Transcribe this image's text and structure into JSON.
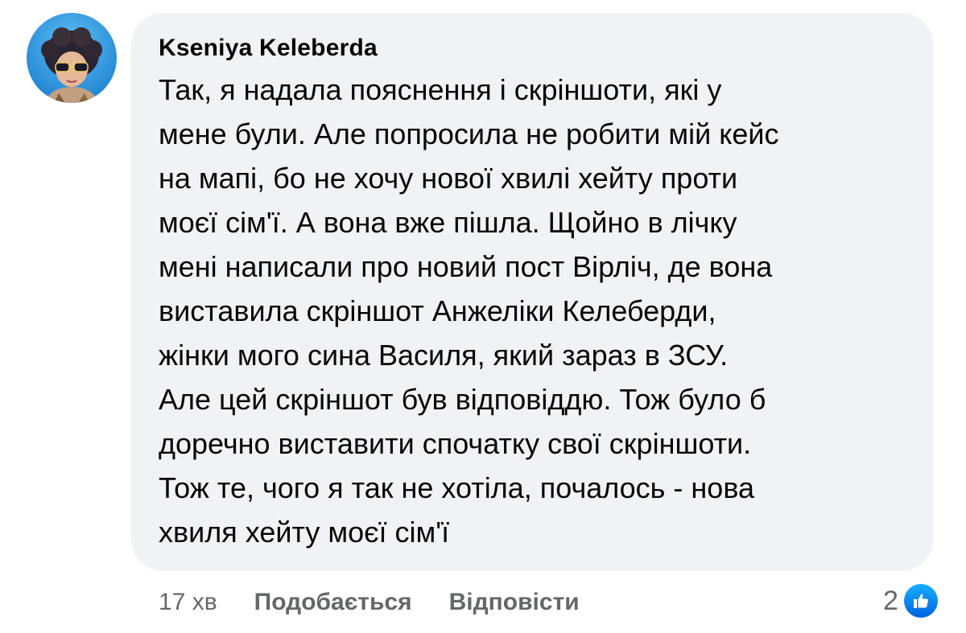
{
  "comment": {
    "author": "Kseniya  Keleberda",
    "text_lines": [
      "Так, я надала пояснення і скріншоти, які у",
      "мене були. Але попросила не робити мій кейс",
      "на мапі, бо не хочу нової хвилі хейту проти",
      "моєї сім'ї. А вона вже пішла. Щойно в лічку",
      "мені написали про новий пост Вірліч, де вона",
      "виставила скріншот Анжеліки Келеберди,",
      "жінки мого сина Василя, який зараз в ЗСУ.",
      "Але цей скріншот був відповіддю. Тож було б",
      "доречно виставити спочатку свої скріншоти.",
      "Тож те, чого я так не хотіла, почалось - нова",
      "хвиля хейту моєї сім'ї"
    ]
  },
  "actions": {
    "time": "17 хв",
    "like_label": "Подобається",
    "reply_label": "Відповісти"
  },
  "reactions": {
    "count": "2",
    "icon": "thumbs-up-icon",
    "color": "#1877f2"
  },
  "colors": {
    "bubble_bg": "#f0f2f5",
    "text": "#050505",
    "secondary": "#65676b"
  }
}
